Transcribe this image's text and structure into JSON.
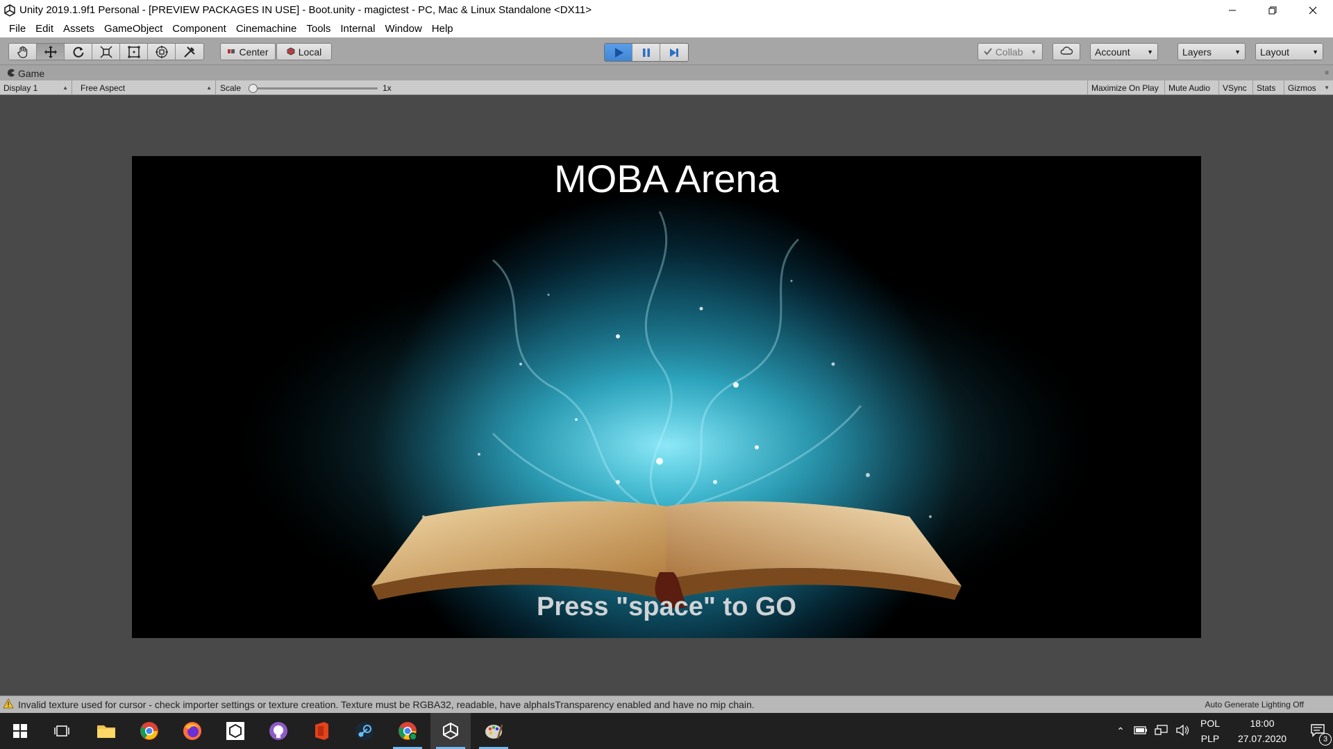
{
  "window": {
    "title": "Unity 2019.1.9f1 Personal - [PREVIEW PACKAGES IN USE] - Boot.unity - magictest - PC, Mac & Linux Standalone <DX11>",
    "controls": [
      "minimize",
      "restore",
      "close"
    ]
  },
  "menu": [
    "File",
    "Edit",
    "Assets",
    "GameObject",
    "Component",
    "Cinemachine",
    "Tools",
    "Internal",
    "Window",
    "Help"
  ],
  "toolbar": {
    "tools": [
      "hand-tool",
      "move-tool",
      "rotate-tool",
      "scale-tool",
      "rect-tool",
      "transform-tool",
      "custom-tool"
    ],
    "active_tool": "move-tool",
    "pivot_label": "Center",
    "space_label": "Local",
    "play_state": {
      "play": true,
      "pause": false
    },
    "collab_label": "Collab",
    "account_label": "Account",
    "layers_label": "Layers",
    "layout_label": "Layout"
  },
  "game_tab": {
    "label": "Game"
  },
  "game_bar": {
    "display": "Display 1",
    "aspect": "Free Aspect",
    "scale_label": "Scale",
    "scale_value": "1x",
    "scale_level": 0,
    "toggles": [
      "Maximize On Play",
      "Mute Audio",
      "VSync",
      "Stats",
      "Gizmos"
    ]
  },
  "game_view": {
    "title": "MOBA Arena",
    "prompt": "Press \"space\" to GO"
  },
  "status": {
    "message": "Invalid texture used for cursor - check importer settings or texture creation. Texture must be RGBA32, readable, have alphaIsTransparency enabled and have no mip chain.",
    "right": "Auto Generate Lighting Off"
  },
  "taskbar": {
    "apps": [
      "start",
      "task-view",
      "file-explorer",
      "chrome",
      "firefox",
      "unity-hub",
      "github-desktop",
      "office",
      "steam",
      "chrome-profile",
      "unity",
      "paint"
    ],
    "tray": {
      "language": "POL",
      "locale": "PLP",
      "time": "18:00",
      "date": "27.07.2020",
      "notifications": "3"
    }
  },
  "colors": {
    "play_active": "#3f86d6",
    "toolbar_bg": "#a6a6a6",
    "viewport_bg": "#494949",
    "taskbar_bg": "#202020"
  }
}
